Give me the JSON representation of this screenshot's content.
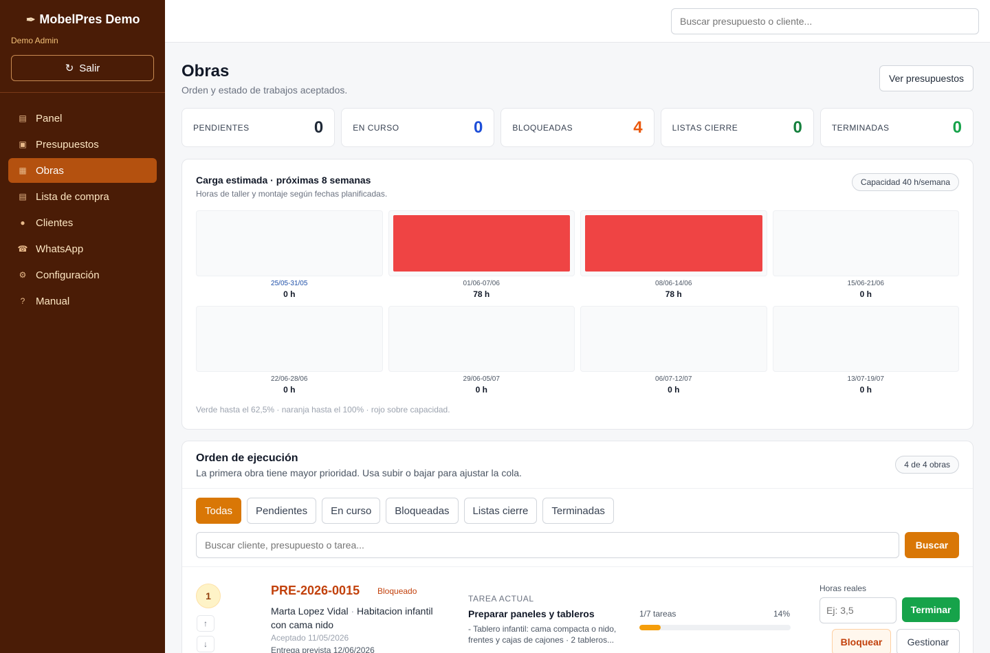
{
  "sidebar": {
    "brand": "MobelPres Demo",
    "brand_icon": "feather-icon",
    "user": "Demo Admin",
    "logout": "Salir",
    "items": [
      {
        "label": "Panel",
        "icon": "grid-icon",
        "active": false
      },
      {
        "label": "Presupuestos",
        "icon": "document-icon",
        "active": false
      },
      {
        "label": "Obras",
        "icon": "grid-icon",
        "active": true
      },
      {
        "label": "Lista de compra",
        "icon": "list-icon",
        "active": false
      },
      {
        "label": "Clientes",
        "icon": "user-icon",
        "active": false
      },
      {
        "label": "WhatsApp",
        "icon": "phone-icon",
        "active": false
      },
      {
        "label": "Configuración",
        "icon": "gear-icon",
        "active": false
      },
      {
        "label": "Manual",
        "icon": "help-icon",
        "active": false
      }
    ]
  },
  "topbar": {
    "search_placeholder": "Buscar presupuesto o cliente..."
  },
  "page": {
    "title": "Obras",
    "subtitle": "Orden y estado de trabajos aceptados.",
    "view_budgets": "Ver presupuestos"
  },
  "stats": [
    {
      "label": "PENDIENTES",
      "value": "0",
      "color": "#1f2937"
    },
    {
      "label": "EN CURSO",
      "value": "0",
      "color": "#1d4ed8"
    },
    {
      "label": "BLOQUEADAS",
      "value": "4",
      "color": "#ea580c"
    },
    {
      "label": "LISTAS CIERRE",
      "value": "0",
      "color": "#15803d"
    },
    {
      "label": "TERMINADAS",
      "value": "0",
      "color": "#16a34a"
    }
  ],
  "load": {
    "title": "Carga estimada · próximas 8 semanas",
    "subtitle": "Horas de taller y montaje según fechas planificadas.",
    "capacity": "Capacidad 40 h/semana",
    "legend": "Verde hasta el 62,5% · naranja hasta el 100% · rojo sobre capacidad.",
    "over_color": "#ef4444"
  },
  "chart_data": {
    "type": "bar",
    "categories": [
      "25/05-31/05",
      "01/06-07/06",
      "08/06-14/06",
      "15/06-21/06",
      "22/06-28/06",
      "29/06-05/07",
      "06/07-12/07",
      "13/07-19/07"
    ],
    "values": [
      0,
      78,
      78,
      0,
      0,
      0,
      0,
      0
    ],
    "value_labels": [
      "0 h",
      "78 h",
      "78 h",
      "0 h",
      "0 h",
      "0 h",
      "0 h",
      "0 h"
    ],
    "capacity": 40,
    "ylim": [
      0,
      40
    ],
    "title": "Carga estimada · próximas 8 semanas"
  },
  "order": {
    "title": "Orden de ejecución",
    "subtitle": "La primera obra tiene mayor prioridad. Usa subir o bajar para ajustar la cola.",
    "count": "4 de 4 obras",
    "filters": [
      "Todas",
      "Pendientes",
      "En curso",
      "Bloqueadas",
      "Listas cierre",
      "Terminadas"
    ],
    "active_filter": 0,
    "search_placeholder": "Buscar cliente, presupuesto o tarea...",
    "search_button": "Buscar"
  },
  "rows": [
    {
      "priority": "1",
      "code": "PRE-2026-0015",
      "status": "Bloqueado",
      "client": "Marta Lopez Vidal",
      "project": "Habitacion infantil con cama nido",
      "accepted": "Aceptado 11/05/2026",
      "delivery": "Entrega prevista 12/06/2026",
      "task_label": "TAREA ACTUAL",
      "task_title": "Preparar paneles y tableros",
      "task_desc": "- Tablero infantil: cama compacta o nido, frentes y cajas de cajones · 2 tableros...",
      "progress_label": "1/7 tareas",
      "progress_pct": "14%",
      "progress": 0.14,
      "hours_label": "Horas reales",
      "hours_placeholder": "Ej: 3,5",
      "finish": "Terminar",
      "block": "Bloquear",
      "manage": "Gestionar"
    }
  ]
}
